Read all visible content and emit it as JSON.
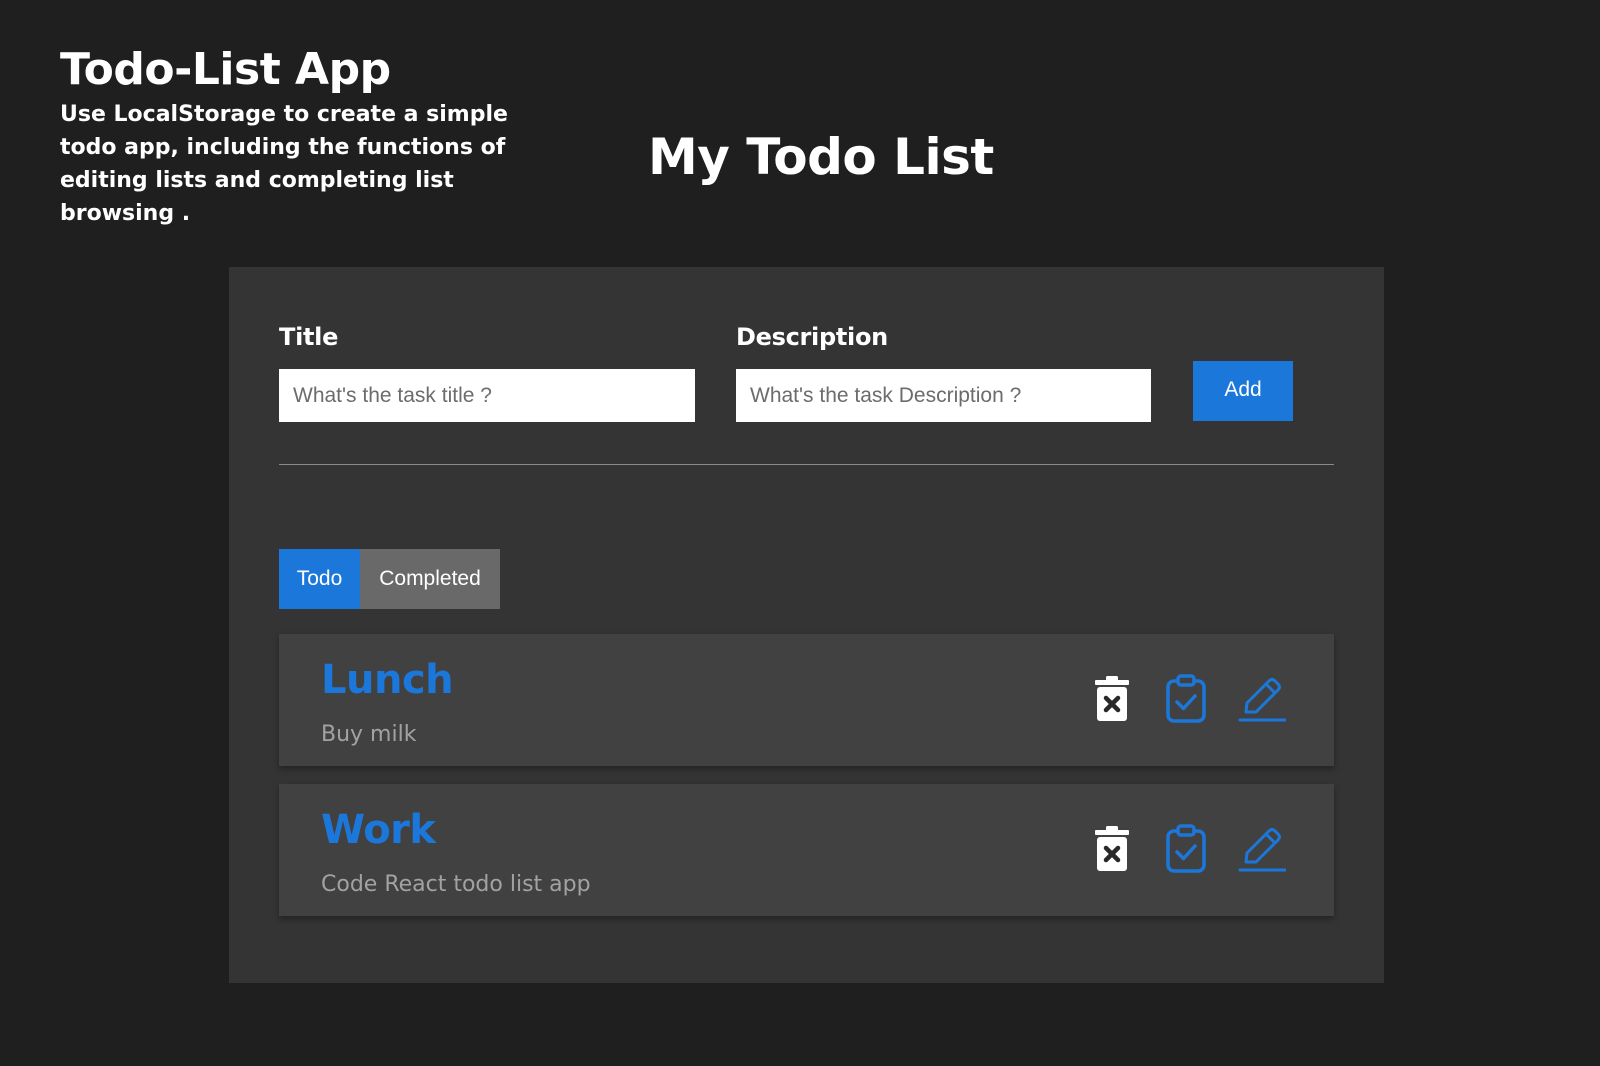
{
  "intro": {
    "title": "Todo-List App",
    "description": "Use LocalStorage to create a simple todo app, including the functions of editing lists and completing list browsing ."
  },
  "heading": "My Todo List",
  "form": {
    "title_label": "Title",
    "title_placeholder": "What's the task title ?",
    "title_value": "",
    "description_label": "Description",
    "description_placeholder": "What's the task Description ?",
    "description_value": "",
    "add_label": "Add"
  },
  "tabs": [
    {
      "label": "Todo",
      "active": true
    },
    {
      "label": "Completed",
      "active": false
    }
  ],
  "todos": [
    {
      "title": "Lunch",
      "description": "Buy milk"
    },
    {
      "title": "Work",
      "description": "Code React todo list app"
    }
  ],
  "icons": {
    "delete": "trash-icon",
    "complete": "clipboard-check-icon",
    "edit": "pencil-icon"
  },
  "colors": {
    "background": "#201f20",
    "panel": "#353435",
    "item": "#424142",
    "accent": "#1b78da",
    "tab_inactive": "#6a696a",
    "muted_text": "#a3a2a3"
  }
}
